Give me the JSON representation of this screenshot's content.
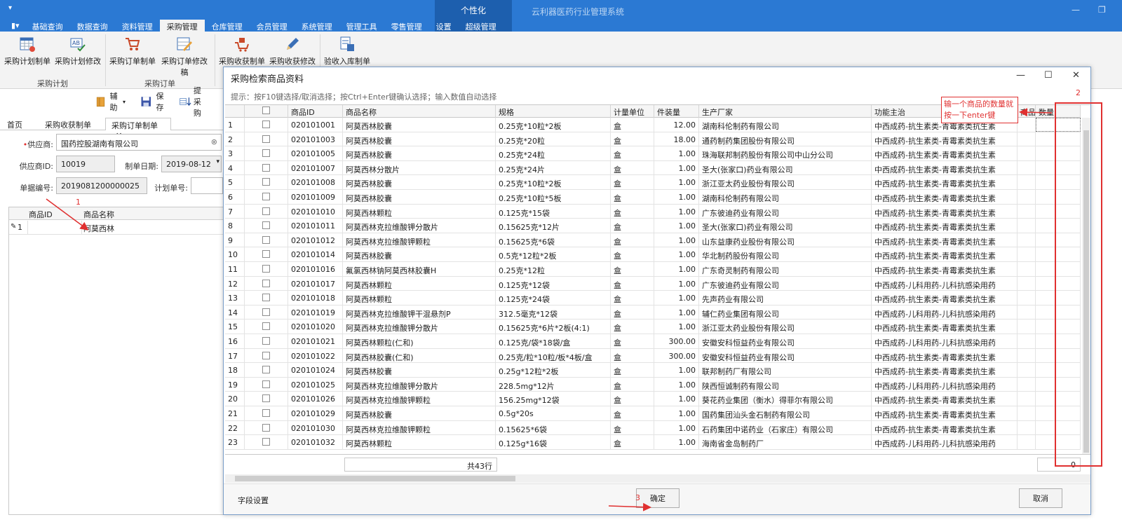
{
  "titlebar": {
    "app_title": "云利器医药行业管理系统",
    "context_tab_group": "个性化",
    "menu_icon": "menu-icon",
    "tabs": [
      "基础查询",
      "数据查询",
      "资料管理",
      "采购管理",
      "仓库管理",
      "会员管理",
      "系统管理",
      "管理工具",
      "零售管理",
      "设置",
      "超级管理"
    ]
  },
  "ribbon": {
    "buttons": [
      "采购计划制单",
      "采购计划修改",
      "采购订单制单",
      "采购订单修改稿",
      "采购收获制单",
      "采购收获修改",
      "验收入库制单"
    ],
    "groups": [
      "采购计划",
      "采购订单"
    ]
  },
  "toolbar2": {
    "assist": "辅助",
    "save": "保存",
    "fetch": "提采购"
  },
  "doc_tabs": [
    "首页",
    "采购收获制单",
    "采购订单制单"
  ],
  "form": {
    "supplier_label": "供应商:",
    "supplier_value": "国药控股湖南有限公司",
    "supplier_id_label": "供应商ID:",
    "supplier_id_value": "10019",
    "date_label": "制单日期:",
    "date_value": "2019-08-12",
    "doc_no_label": "单据编号:",
    "doc_no_value": "2019081200000025",
    "plan_no_label": "计划单号:"
  },
  "left_grid": {
    "headers": [
      "商品ID",
      "商品名称"
    ],
    "row_no": "1",
    "row_name": "阿莫西林"
  },
  "dialog": {
    "title": "采购检索商品资料",
    "hint": "提示：按F10键选择/取消选择；按Ctrl+Enter键确认选择；输入数值自动选择",
    "headers": [
      "商品ID",
      "商品名称",
      "规格",
      "计量单位",
      "件装量",
      "生产厂家",
      "功能主治",
      "商品",
      "数量"
    ],
    "rows": [
      [
        "1",
        "020101001",
        "阿莫西林胶囊",
        "0.25克*10粒*2板",
        "盒",
        "12.00",
        "湖南科伦制药有限公司",
        "中西成药-抗生素类-青霉素类抗生素"
      ],
      [
        "2",
        "020101003",
        "阿莫西林胶囊",
        "0.25克*20粒",
        "盒",
        "18.00",
        "通药制药集团股份有限公司",
        "中西成药-抗生素类-青霉素类抗生素"
      ],
      [
        "3",
        "020101005",
        "阿莫西林胶囊",
        "0.25克*24粒",
        "盒",
        "1.00",
        "珠海联邦制药股份有限公司中山分公司",
        "中西成药-抗生素类-青霉素类抗生素"
      ],
      [
        "4",
        "020101007",
        "阿莫西林分散片",
        "0.25克*24片",
        "盒",
        "1.00",
        "圣大(张家口)药业有限公司",
        "中西成药-抗生素类-青霉素类抗生素"
      ],
      [
        "5",
        "020101008",
        "阿莫西林胶囊",
        "0.25克*10粒*2板",
        "盒",
        "1.00",
        "浙江亚太药业股份有限公司",
        "中西成药-抗生素类-青霉素类抗生素"
      ],
      [
        "6",
        "020101009",
        "阿莫西林胶囊",
        "0.25克*10粒*5板",
        "盒",
        "1.00",
        "湖南科伦制药有限公司",
        "中西成药-抗生素类-青霉素类抗生素"
      ],
      [
        "7",
        "020101010",
        "阿莫西林颗粒",
        "0.125克*15袋",
        "盒",
        "1.00",
        "广东彼迪药业有限公司",
        "中西成药-抗生素类-青霉素类抗生素"
      ],
      [
        "8",
        "020101011",
        "阿莫西林克拉维酸钾分散片",
        "0.15625克*12片",
        "盒",
        "1.00",
        "圣大(张家口)药业有限公司",
        "中西成药-抗生素类-青霉素类抗生素"
      ],
      [
        "9",
        "020101012",
        "阿莫西林克拉维酸钾颗粒",
        "0.15625克*6袋",
        "盒",
        "1.00",
        "山东益康药业股份有限公司",
        "中西成药-抗生素类-青霉素类抗生素"
      ],
      [
        "10",
        "020101014",
        "阿莫西林胶囊",
        "0.5克*12粒*2板",
        "盒",
        "1.00",
        "华北制药股份有限公司",
        "中西成药-抗生素类-青霉素类抗生素"
      ],
      [
        "11",
        "020101016",
        "氟氯西林钠阿莫西林胶囊H",
        "0.25克*12粒",
        "盒",
        "1.00",
        "广东奇灵制药有限公司",
        "中西成药-抗生素类-青霉素类抗生素"
      ],
      [
        "12",
        "020101017",
        "阿莫西林颗粒",
        "0.125克*12袋",
        "盒",
        "1.00",
        "广东彼迪药业有限公司",
        "中西成药-儿科用药-儿科抗感染用药"
      ],
      [
        "13",
        "020101018",
        "阿莫西林颗粒",
        "0.125克*24袋",
        "盒",
        "1.00",
        "先声药业有限公司",
        "中西成药-抗生素类-青霉素类抗生素"
      ],
      [
        "14",
        "020101019",
        "阿莫西林克拉维酸钾干混悬剂P",
        "312.5毫克*12袋",
        "盒",
        "1.00",
        "辅仁药业集团有限公司",
        "中西成药-儿科用药-儿科抗感染用药"
      ],
      [
        "15",
        "020101020",
        "阿莫西林克拉维酸钾分散片",
        "0.15625克*6片*2板(4:1)",
        "盒",
        "1.00",
        "浙江亚太药业股份有限公司",
        "中西成药-抗生素类-青霉素类抗生素"
      ],
      [
        "16",
        "020101021",
        "阿莫西林颗粒(仁和)",
        "0.125克/袋*18袋/盒",
        "盒",
        "300.00",
        "安徽安科恒益药业有限公司",
        "中西成药-儿科用药-儿科抗感染用药"
      ],
      [
        "17",
        "020101022",
        "阿莫西林胶囊(仁和)",
        "0.25克/粒*10粒/板*4板/盒",
        "盒",
        "300.00",
        "安徽安科恒益药业有限公司",
        "中西成药-抗生素类-青霉素类抗生素"
      ],
      [
        "18",
        "020101024",
        "阿莫西林胶囊",
        "0.25g*12粒*2板",
        "盒",
        "1.00",
        "联邦制药厂有限公司",
        "中西成药-抗生素类-青霉素类抗生素"
      ],
      [
        "19",
        "020101025",
        "阿莫西林克拉维酸钾分散片",
        "228.5mg*12片",
        "盒",
        "1.00",
        "陕西恒诚制药有限公司",
        "中西成药-儿科用药-儿科抗感染用药"
      ],
      [
        "20",
        "020101026",
        "阿莫西林克拉维酸钾颗粒",
        "156.25mg*12袋",
        "盒",
        "1.00",
        "葵花药业集团（衡水）得菲尔有限公司",
        "中西成药-抗生素类-青霉素类抗生素"
      ],
      [
        "21",
        "020101029",
        "阿莫西林胶囊",
        "0.5g*20s",
        "盒",
        "1.00",
        "国药集团汕头金石制药有限公司",
        "中西成药-抗生素类-青霉素类抗生素"
      ],
      [
        "22",
        "020101030",
        "阿莫西林克拉维酸钾颗粒",
        "0.15625*6袋",
        "盒",
        "1.00",
        "石药集团中诺药业（石家庄）有限公司",
        "中西成药-抗生素类-青霉素类抗生素"
      ],
      [
        "23",
        "020101032",
        "阿莫西林颗粒",
        "0.125g*16袋",
        "盒",
        "1.00",
        "海南省金岛制药厂",
        "中西成药-儿科用药-儿科抗感染用药"
      ]
    ],
    "total_rows": "共43行",
    "qty_total": "0",
    "field_settings": "字段设置",
    "confirm": "确定",
    "cancel": "取消"
  },
  "annotations": {
    "n1": "1",
    "n2": "2",
    "n3": "3",
    "note": "输一个商品的数量就按一下enter键"
  },
  "colors": {
    "title_blue": "#2b79d3",
    "context_blue": "#1d5fae",
    "annotation_red": "#e03030"
  }
}
